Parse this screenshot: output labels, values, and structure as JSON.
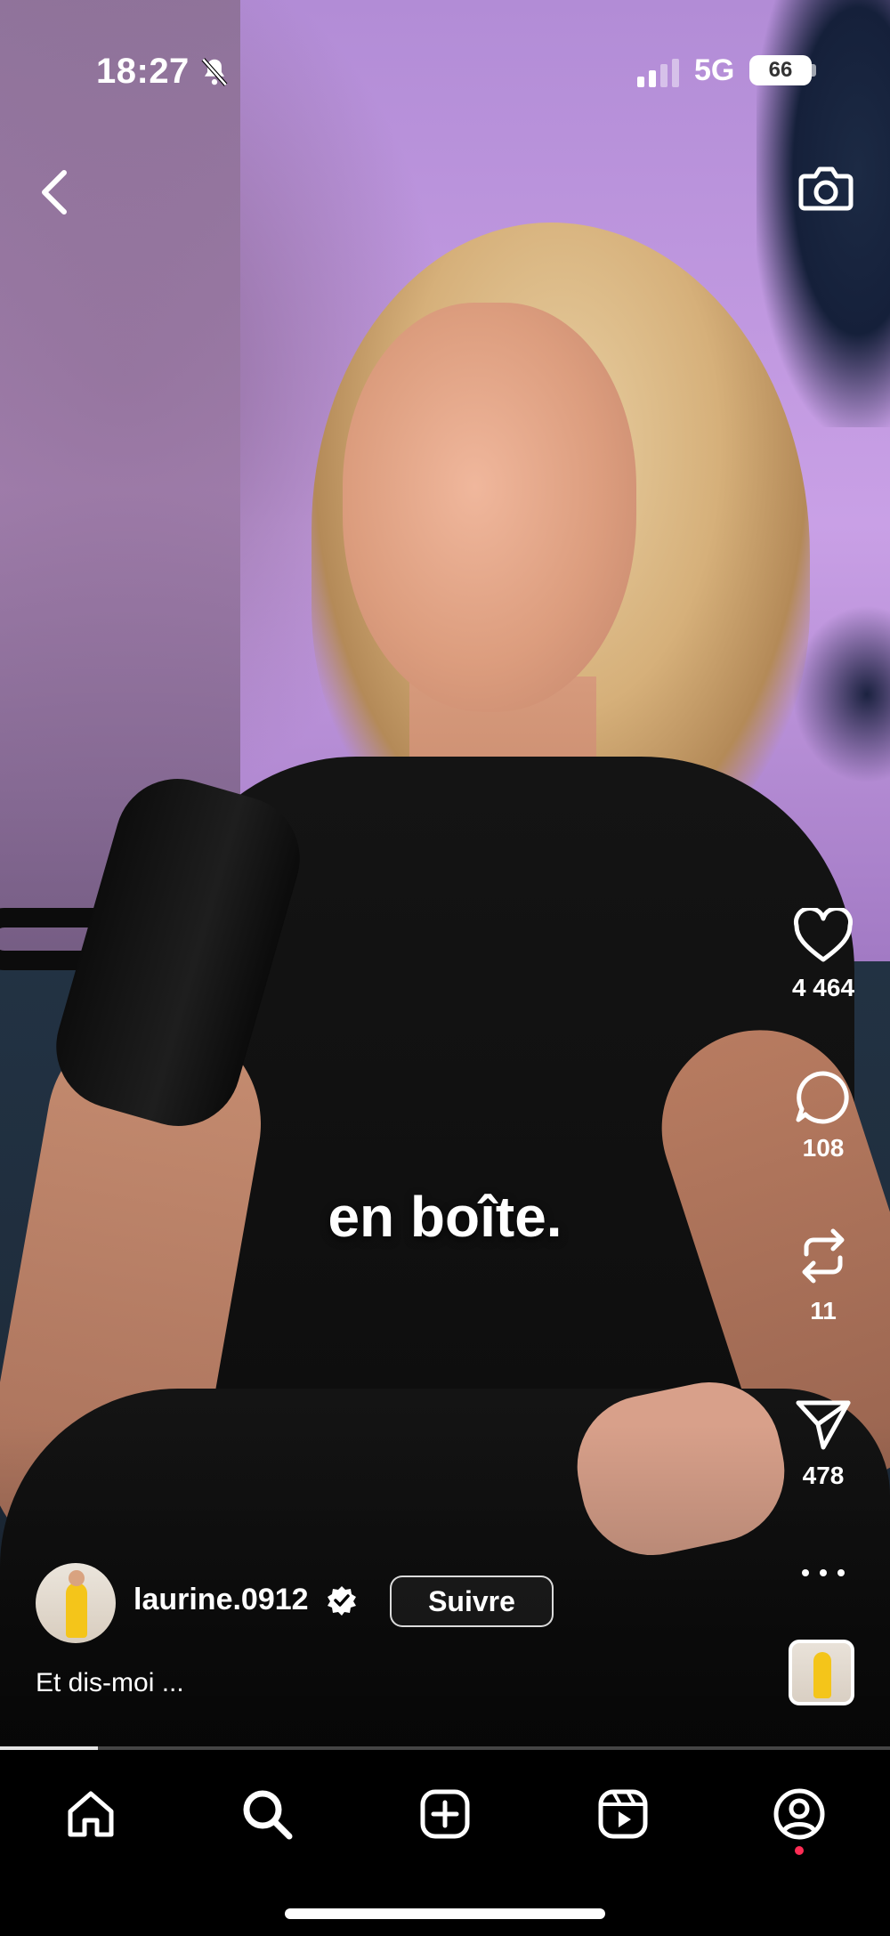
{
  "status_bar": {
    "time": "18:27",
    "network": "5G",
    "battery": "66",
    "icons": [
      "bell-slash-icon",
      "signal-icon"
    ]
  },
  "top_bar": {
    "icons": [
      "back-chevron-icon",
      "camera-icon"
    ]
  },
  "video": {
    "caption_overlay": "en boîte.",
    "progress_fraction": 0.11
  },
  "actions": {
    "like_count": "4 464",
    "comment_count": "108",
    "repost_count": "11",
    "share_count": "478",
    "icons": [
      "heart-icon",
      "comment-icon",
      "repost-icon",
      "send-icon",
      "more-icon"
    ]
  },
  "author": {
    "username": "laurine.0912",
    "follow_label": "Suivre",
    "caption": "Et dis-moi ..."
  },
  "bottom_nav": {
    "items": [
      "home-icon",
      "search-icon",
      "create-icon",
      "reels-icon",
      "profile-icon"
    ],
    "notification_color": "#ff2d55"
  }
}
